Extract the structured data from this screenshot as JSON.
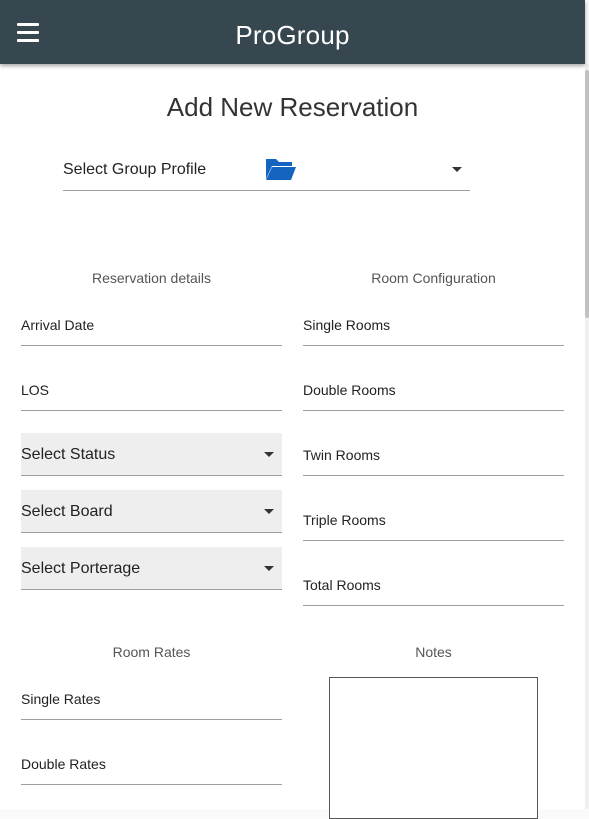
{
  "app": {
    "title": "ProGroup"
  },
  "page": {
    "title": "Add New Reservation"
  },
  "group_profile": {
    "label": "Select Group Profile"
  },
  "reservation_details": {
    "heading": "Reservation details",
    "arrival_date": "Arrival Date",
    "los": "LOS",
    "status": "Select Status",
    "board": "Select Board",
    "porterage": "Select Porterage"
  },
  "room_configuration": {
    "heading": "Room Configuration",
    "single": "Single Rooms",
    "double": "Double Rooms",
    "twin": "Twin Rooms",
    "triple": "Triple Rooms",
    "total": "Total Rooms"
  },
  "room_rates": {
    "heading": "Room Rates",
    "single": "Single Rates",
    "double": "Double Rates"
  },
  "notes": {
    "heading": "Notes",
    "value": ""
  },
  "icons": {
    "menu": "hamburger-menu-icon",
    "folder": "folder-open-icon",
    "dropdown": "caret-down-icon"
  },
  "colors": {
    "topbar": "#37474f",
    "folder": "#1565c0",
    "select_bg": "#eeeeee"
  }
}
